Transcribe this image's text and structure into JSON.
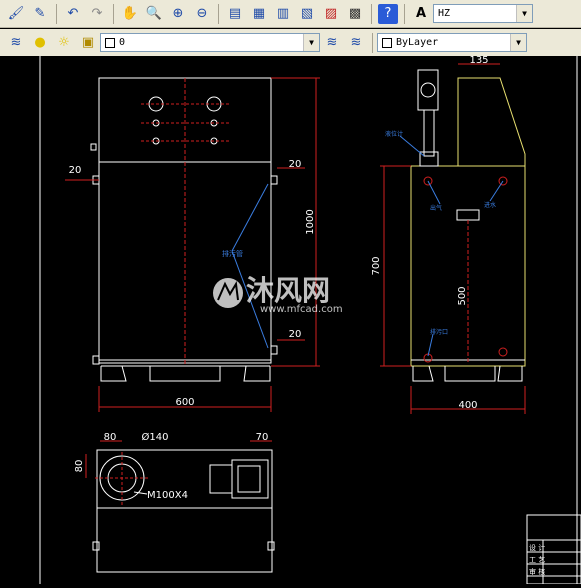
{
  "toolbar_top": {
    "icons": [
      "brush-icon",
      "match-properties-icon",
      "undo-icon",
      "redo-icon",
      "pan-icon",
      "zoom-realtime-icon",
      "zoom-window-icon",
      "zoom-previous-icon",
      "properties-icon",
      "design-center-icon",
      "tool-palettes-icon",
      "sheet-set-icon",
      "markup-icon",
      "calculator-icon",
      "help-icon",
      "text-style-icon"
    ],
    "text_style_value": "HZ"
  },
  "toolbar_layer": {
    "layer_value": "0",
    "color_value": "ByLayer"
  },
  "drawing": {
    "dims": {
      "front_width": "600",
      "front_height": "1000",
      "front_left_20": "20",
      "front_right_top_20": "20",
      "front_right_bottom_20": "20",
      "side_top": "135",
      "side_height": "700",
      "side_width": "400",
      "side_inner": "500",
      "top_80_h": "80",
      "top_80_v": "80",
      "top_dia": "Ø140",
      "top_70": "70",
      "top_bolt": "M100X4"
    },
    "title_block": [
      "设 计",
      "工 艺",
      "审 核"
    ],
    "watermark_cn": "沐风网",
    "watermark_url": "www.mfcad.com"
  }
}
